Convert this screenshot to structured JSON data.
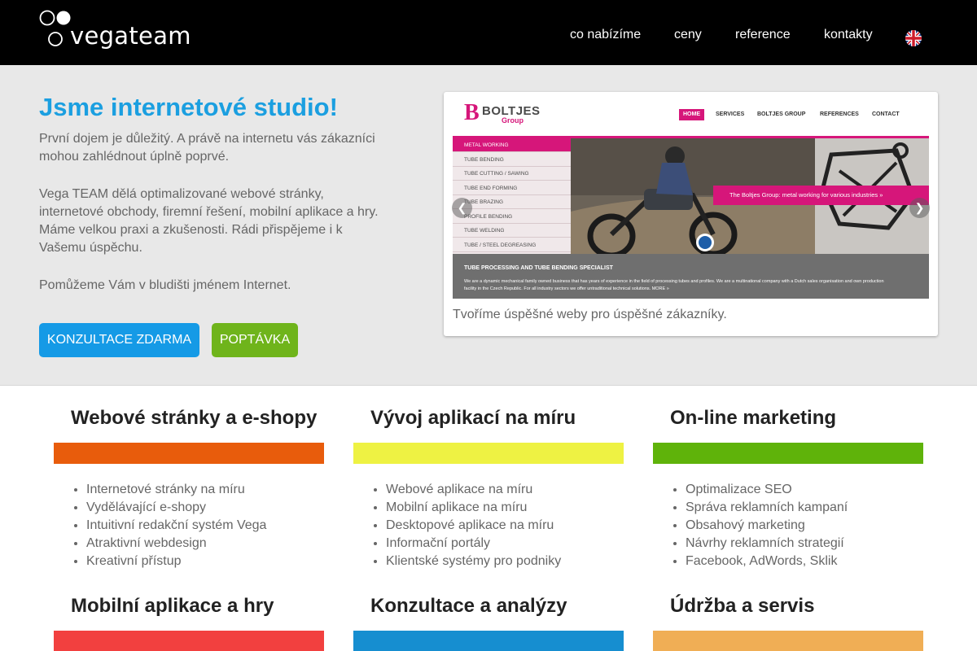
{
  "header": {
    "logo_text": "vegateam",
    "nav": [
      "co nabízíme",
      "ceny",
      "reference",
      "kontakty"
    ],
    "language_icon": "uk-flag-icon"
  },
  "hero": {
    "title": "Jsme internetové studio!",
    "paragraphs": [
      "První dojem je důležitý. A právě na internetu vás zákazníci mohou zahlédnout úplně poprvé.",
      "Vega TEAM dělá optimalizované webové stránky, internetové obchody, firemní řešení, mobilní aplikace a hry. Máme velkou praxi a zkušenosti. Rádi přispějeme i k Vašemu úspěchu.",
      "Pomůžeme Vám v bludišti jménem Internet."
    ],
    "buttons": {
      "consult": "KONZULTACE ZDARMA",
      "inquiry": "POPTÁVKA"
    },
    "colors": {
      "title": "#1b9fe0",
      "consult_button": "#159ae6",
      "inquiry_button": "#6fb41b"
    }
  },
  "slider": {
    "caption": "Tvoříme úspěšné weby pro úspěšné zákazníky.",
    "prev_icon": "chevron-left-icon",
    "next_icon": "chevron-right-icon",
    "slide": {
      "logo_letter": "B",
      "logo_name": "BOLTJES",
      "logo_sub": "Group",
      "nav": [
        "HOME",
        "SERVICES",
        "BOLTJES GROUP",
        "REFERENCES",
        "CONTACT"
      ],
      "menu": [
        "METAL WORKING",
        "TUBE BENDING",
        "TUBE CUTTING / SAWING",
        "TUBE END FORMING",
        "TUBE BRAZING",
        "PROFILE BENDING",
        "TUBE WELDING",
        "TUBE / STEEL DEGREASING"
      ],
      "banner": "The Boltjes Group: metal working for various industries   »",
      "bottom_title": "TUBE PROCESSING AND TUBE BENDING SPECIALIST",
      "bottom_text": "We are a dynamic mechanical family owned business that has years of experience in the field of processing tubes and profiles. We are a multinational company with a Dutch sales organisation and own production facility in the Czech Republic. For all industry sectors we offer untraditional technical solutions.      MORE »"
    }
  },
  "services": [
    {
      "title": "Webové stránky a e-shopy",
      "color": "#e85c0c",
      "items": [
        "Internetové stránky na míru",
        "Vydělávající e-shopy",
        "Intuitivní redakční systém Vega",
        "Atraktivní webdesign",
        "Kreativní přístup"
      ]
    },
    {
      "title": "Vývoj aplikací na míru",
      "color": "#eef243",
      "items": [
        "Webové aplikace na míru",
        "Mobilní aplikace na míru",
        "Desktopové aplikace na míru",
        "Informační portály",
        "Klientské systémy pro podniky"
      ]
    },
    {
      "title": "On-line marketing",
      "color": "#5fb30a",
      "items": [
        "Optimalizace SEO",
        "Správa reklamních kampaní",
        "Obsahový marketing",
        "Návrhy reklamních strategií",
        "Facebook, AdWords, Sklik"
      ]
    },
    {
      "title": "Mobilní aplikace a hry",
      "color": "#f2403f",
      "items": []
    },
    {
      "title": "Konzultace a analýzy",
      "color": "#168ed0",
      "items": []
    },
    {
      "title": "Údržba a servis",
      "color": "#f0ae55",
      "items": []
    }
  ]
}
